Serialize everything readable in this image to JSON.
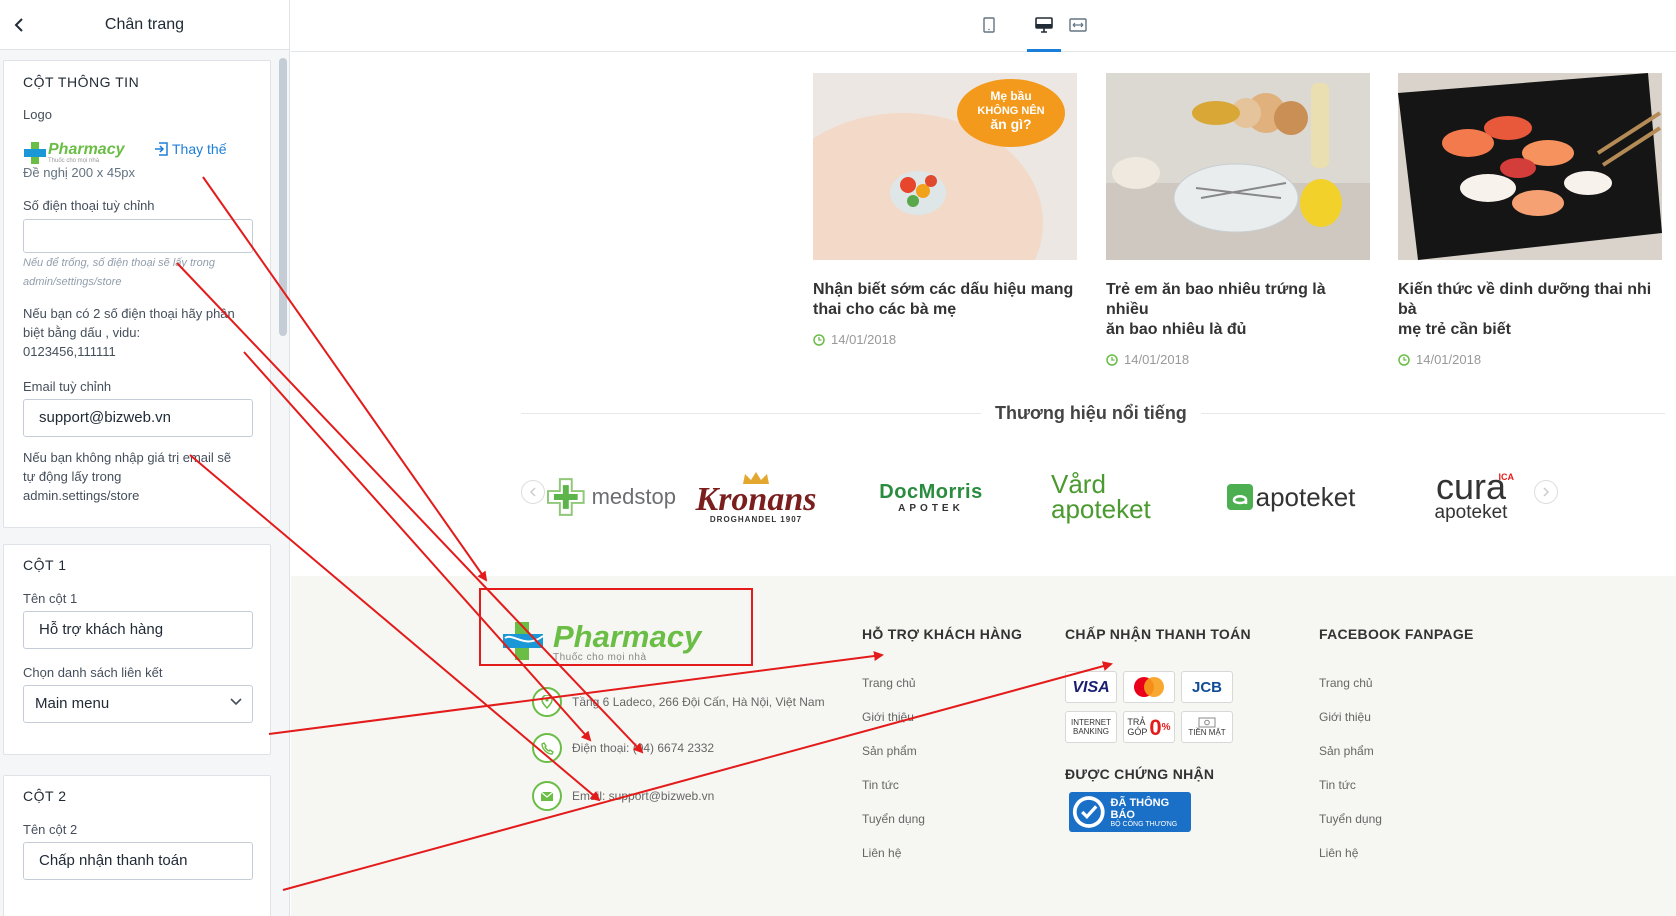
{
  "panel": {
    "title": "Chân trang",
    "info_section": {
      "title": "CỘT THÔNG TIN",
      "logo_label": "Logo",
      "replace_label": "Thay thế",
      "logo_hint": "Đề nghị 200 x 45px",
      "phone_label": "Số điện thoại tuỳ chỉnh",
      "phone_value": "",
      "phone_hint_line1": "Nếu để trống, số điện thoại sẽ lấy trong",
      "phone_hint_line2": "admin/settings/store",
      "phone_note_line1": "Nếu bạn có 2 số điện thoại hãy phân",
      "phone_note_line2": "biệt bằng dấu , vidu:",
      "phone_note_line3": "0123456,111111",
      "email_label": "Email tuỳ chỉnh",
      "email_value": "support@bizweb.vn",
      "email_note_line1": "Nếu bạn không nhập giá trị email sẽ",
      "email_note_line2": "tự động lấy trong",
      "email_note_line3": "admin.settings/store"
    },
    "col1": {
      "title": "CỘT 1",
      "name_label": "Tên cột 1",
      "name_value": "Hỗ trợ khách hàng",
      "links_label": "Chọn danh sách liên kết",
      "links_value": "Main menu"
    },
    "col2": {
      "title": "CỘT 2",
      "name_label": "Tên cột 2",
      "name_value": "Chấp nhận thanh toán"
    }
  },
  "toolbar": {
    "devices": [
      "mobile-icon",
      "desktop-icon",
      "fullwidth-icon"
    ],
    "active_device": "desktop-icon"
  },
  "news": [
    {
      "title_line1": "Nhận biết sớm các dấu hiệu mang",
      "title_line2": "thai cho các bà mẹ",
      "date": "14/01/2018",
      "badge_line1": "Mẹ bầu",
      "badge_line2": "KHÔNG NÊN",
      "badge_line3": "ăn gì?"
    },
    {
      "title_line1": "Trẻ em ăn bao nhiêu trứng là nhiều",
      "title_line2": "ăn bao nhiêu là đủ",
      "date": "14/01/2018"
    },
    {
      "title_line1": "Kiến thức về dinh dưỡng thai nhi bà",
      "title_line2": "mẹ trẻ cần biết",
      "date": "14/01/2018"
    }
  ],
  "brands": {
    "title": "Thương hiệu nổi tiếng",
    "items": [
      {
        "name": "medstop"
      },
      {
        "name": "Kronans",
        "sub": "DROGHANDEL 1907"
      },
      {
        "name": "DocMorris",
        "sub": "APOTEK"
      },
      {
        "name_line1": "Vård",
        "name_line2": "apoteket"
      },
      {
        "name": "apoteket"
      },
      {
        "name_line1": "cura",
        "name_line2": "apoteket",
        "tag": "ICA"
      }
    ]
  },
  "footer": {
    "logo_text": "Pharmacy",
    "logo_tagline": "Thuốc cho mọi nhà",
    "address": "Tầng 6 Ladeco, 266 Đội Cấn, Hà Nội, Việt Nam",
    "phone": "Điện thoại: (04) 6674 2332",
    "email": "Email: support@bizweb.vn",
    "col1_title": "HỖ TRỢ KHÁCH HÀNG",
    "col1_links": [
      "Trang chủ",
      "Giới thiệu",
      "Sản phẩm",
      "Tin tức",
      "Tuyển dụng",
      "Liên hệ"
    ],
    "col2_title": "CHẤP NHẬN THANH TOÁN",
    "payments": {
      "visa": "VISA",
      "jcb": "JCB",
      "internet_line1": "INTERNET",
      "internet_line2": "BANKING",
      "tragop_line1": "TRẢ",
      "tragop_line2": "GÓP",
      "tragop_big": "0",
      "tragop_pct": "%",
      "cash": "TIỀN MẶT"
    },
    "cert_title": "ĐƯỢC CHỨNG NHẬN",
    "cert_badge_line1": "ĐÃ THÔNG BÁO",
    "cert_badge_line2": "BỘ CÔNG THƯƠNG",
    "col3_title": "FACEBOOK FANPAGE",
    "col3_links": [
      "Trang chủ",
      "Giới thiệu",
      "Sản phẩm",
      "Tin tức",
      "Tuyển dụng",
      "Liên hệ"
    ]
  },
  "logo_small": {
    "text": "Pharmacy",
    "tagline": "Thuốc cho mọi nhà"
  },
  "colors": {
    "accent": "#1b7ed8",
    "annotation_red": "#e31b1b",
    "brand_green": "#6abd45",
    "brand_blue": "#1a97d6"
  }
}
